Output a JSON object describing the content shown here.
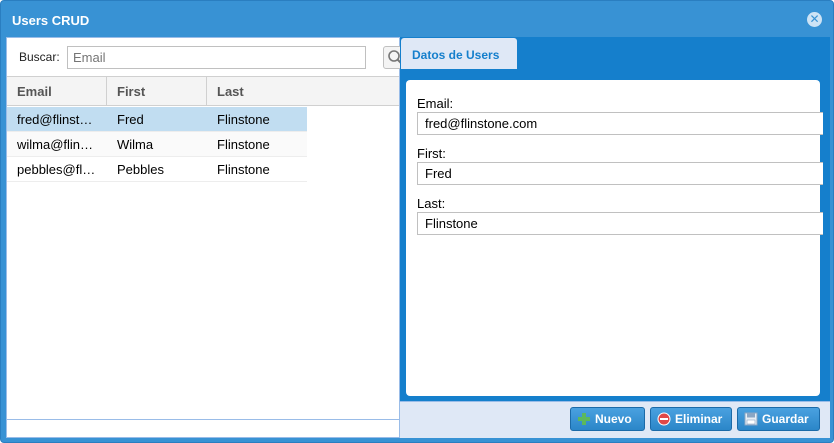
{
  "window": {
    "title": "Users CRUD"
  },
  "search": {
    "label": "Buscar:",
    "placeholder": "Email"
  },
  "grid": {
    "columns": [
      "Email",
      "First",
      "Last"
    ],
    "rows": [
      {
        "email": "fred@flinst…",
        "first": "Fred",
        "last": "Flinstone"
      },
      {
        "email": "wilma@flin…",
        "first": "Wilma",
        "last": "Flinstone"
      },
      {
        "email": "pebbles@fl…",
        "first": "Pebbles",
        "last": "Flinstone"
      }
    ]
  },
  "tab": {
    "label": "Datos de Users"
  },
  "form": {
    "email_label": "Email:",
    "email_value": "fred@flinstone.com",
    "first_label": "First:",
    "first_value": "Fred",
    "last_label": "Last:",
    "last_value": "Flinstone"
  },
  "toolbar": {
    "nuevo": "Nuevo",
    "eliminar": "Eliminar",
    "guardar": "Guardar"
  },
  "icons": {
    "close": "close-icon",
    "search": "search-icon",
    "add": "plus-icon",
    "delete": "minus-circle-icon",
    "save": "floppy-icon"
  }
}
